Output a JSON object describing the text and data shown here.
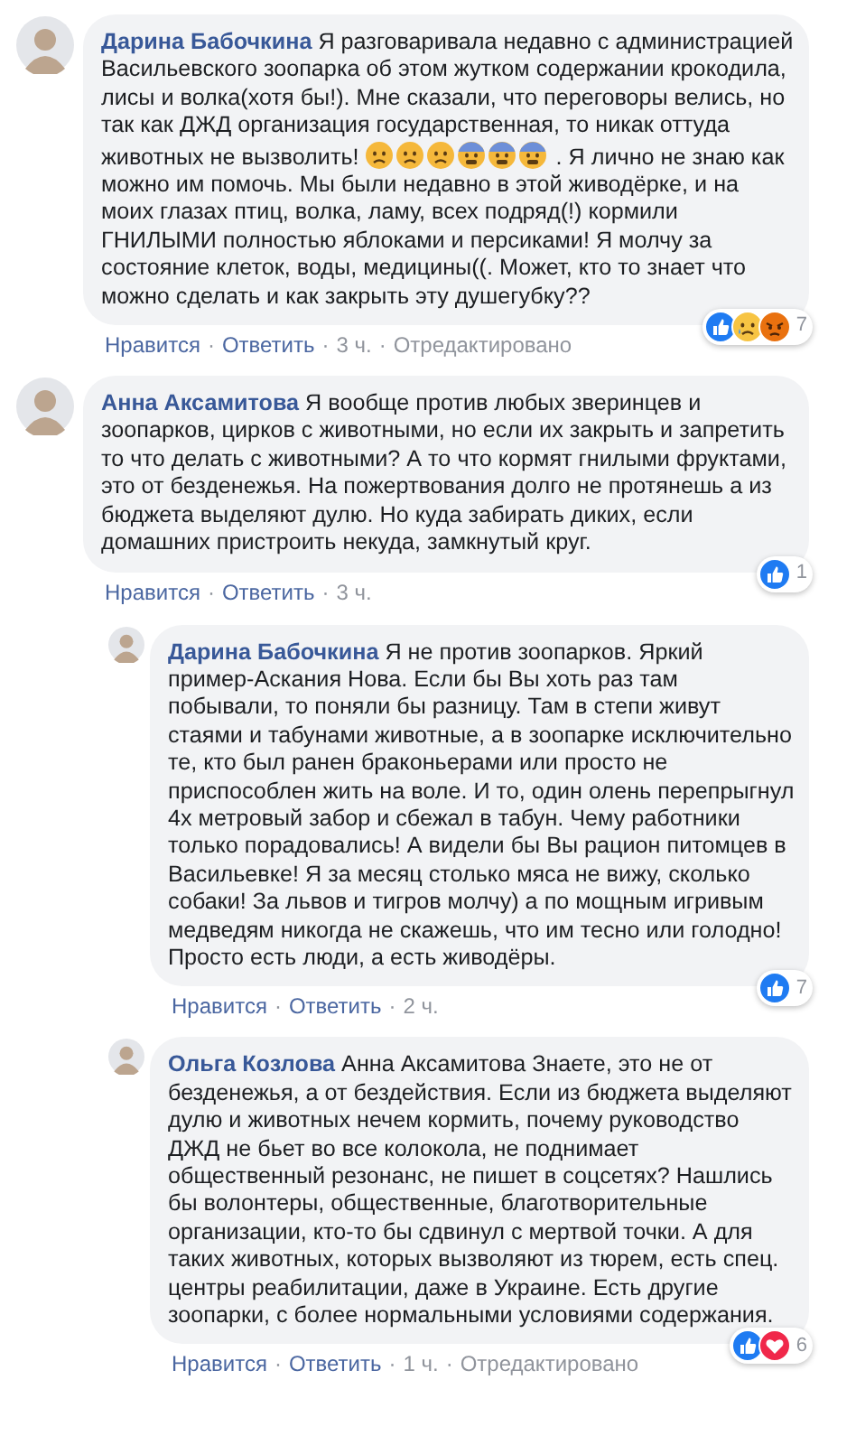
{
  "comments": [
    {
      "author": "Дарина Бабочкина",
      "body": [
        {
          "kind": "text",
          "text": "Я разговаривала недавно с администрацией Васильевского зоопарка об этом жутком содержании крокодила, лисы и волка(хотя бы!). Мне сказали, что переговоры велись, но так как ДЖД организация государственная, то никак оттуда животных не вызволить! "
        },
        {
          "kind": "frown"
        },
        {
          "kind": "frown"
        },
        {
          "kind": "frown"
        },
        {
          "kind": "anxious"
        },
        {
          "kind": "anxious"
        },
        {
          "kind": "anxious"
        },
        {
          "kind": "text",
          "text": " . Я лично не знаю как можно им помочь. Мы были недавно в этой живодёрке, и на моих глазах птиц, волка, ламу, всех подряд(!) кормили ГНИЛЫМИ полностью яблоками и персиками! Я молчу за состояние клеток, воды, медицины((. Может, кто то знает что можно сделать и как закрыть эту душегубку??"
        }
      ],
      "reactions": [
        {
          "kind": "like"
        },
        {
          "kind": "sad"
        },
        {
          "kind": "angry"
        }
      ],
      "reaction_count": "7",
      "actions": [
        {
          "kind": "link",
          "text": "Нравится"
        },
        {
          "kind": "sep",
          "text": "·"
        },
        {
          "kind": "link",
          "text": "Ответить"
        },
        {
          "kind": "sep",
          "text": "·"
        },
        {
          "kind": "time",
          "text": "3 ч."
        },
        {
          "kind": "sep",
          "text": "·"
        },
        {
          "kind": "note",
          "text": "Отредактировано"
        }
      ]
    },
    {
      "author": "Анна Аксамитова",
      "body": [
        {
          "kind": "text",
          "text": "Я вообще против любых зверинцев и зоопарков, цирков с животными, но если их закрыть и запретить то что делать с животными? А то что кормят гнилыми фруктами, это от безденежья. На пожертвования долго не протянешь а из бюджета выделяют дулю. Но куда забирать диких, если домашних пристроить некуда, замкнутый круг."
        }
      ],
      "reactions": [
        {
          "kind": "like"
        }
      ],
      "reaction_count": "1",
      "actions": [
        {
          "kind": "link",
          "text": "Нравится"
        },
        {
          "kind": "sep",
          "text": "·"
        },
        {
          "kind": "link",
          "text": "Ответить"
        },
        {
          "kind": "sep",
          "text": "·"
        },
        {
          "kind": "time",
          "text": "3 ч."
        }
      ],
      "replies": [
        {
          "author": "Дарина Бабочкина",
          "body": [
            {
              "kind": "text",
              "text": "Я не против зоопарков. Яркий пример-Аскания Нова. Если бы Вы хоть раз там побывали, то поняли бы разницу. Там в степи живут стаями и табунами животные, а в зоопарке исключительно те, кто был ранен браконьерами или просто не приспособлен жить на воле. И то, один олень перепрыгнул 4х метровый забор и сбежал в табун. Чему работники только порадовались! А видели бы Вы рацион питомцев в Васильевке! Я за месяц столько мяса не вижу, сколько собаки! За львов и тигров молчу) а по мощным игривым медведям никогда не скажешь, что им тесно или голодно! Просто есть люди, а есть живодёры."
            }
          ],
          "reactions": [
            {
              "kind": "like"
            }
          ],
          "reaction_count": "7",
          "actions": [
            {
              "kind": "link",
              "text": "Нравится"
            },
            {
              "kind": "sep",
              "text": "·"
            },
            {
              "kind": "link",
              "text": "Ответить"
            },
            {
              "kind": "sep",
              "text": "·"
            },
            {
              "kind": "time",
              "text": "2 ч."
            }
          ]
        },
        {
          "author": "Ольга Козлова",
          "body": [
            {
              "kind": "text",
              "text": "Анна Аксамитова Знаете, это не от безденежья, а от бездействия. Если из бюджета выделяют дулю и животных нечем кормить, почему руководство ДЖД не бьет во все колокола, не поднимает общественный резонанс, не пишет в соцсетях? Нашлись бы волонтеры, общественные, благотворительные организации, кто-то бы сдвинул с мертвой точки. А для таких животных, которых вызволяют из тюрем, есть спец. центры реабилитации, даже в Украине. Есть другие зоопарки, с более нормальными условиями содержания."
            }
          ],
          "reactions": [
            {
              "kind": "like"
            },
            {
              "kind": "love"
            }
          ],
          "reaction_count": "6",
          "actions": [
            {
              "kind": "link",
              "text": "Нравится"
            },
            {
              "kind": "sep",
              "text": "·"
            },
            {
              "kind": "link",
              "text": "Ответить"
            },
            {
              "kind": "sep",
              "text": "·"
            },
            {
              "kind": "time",
              "text": "1 ч."
            },
            {
              "kind": "sep",
              "text": "·"
            },
            {
              "kind": "note",
              "text": "Отредактировано"
            }
          ]
        }
      ]
    }
  ]
}
